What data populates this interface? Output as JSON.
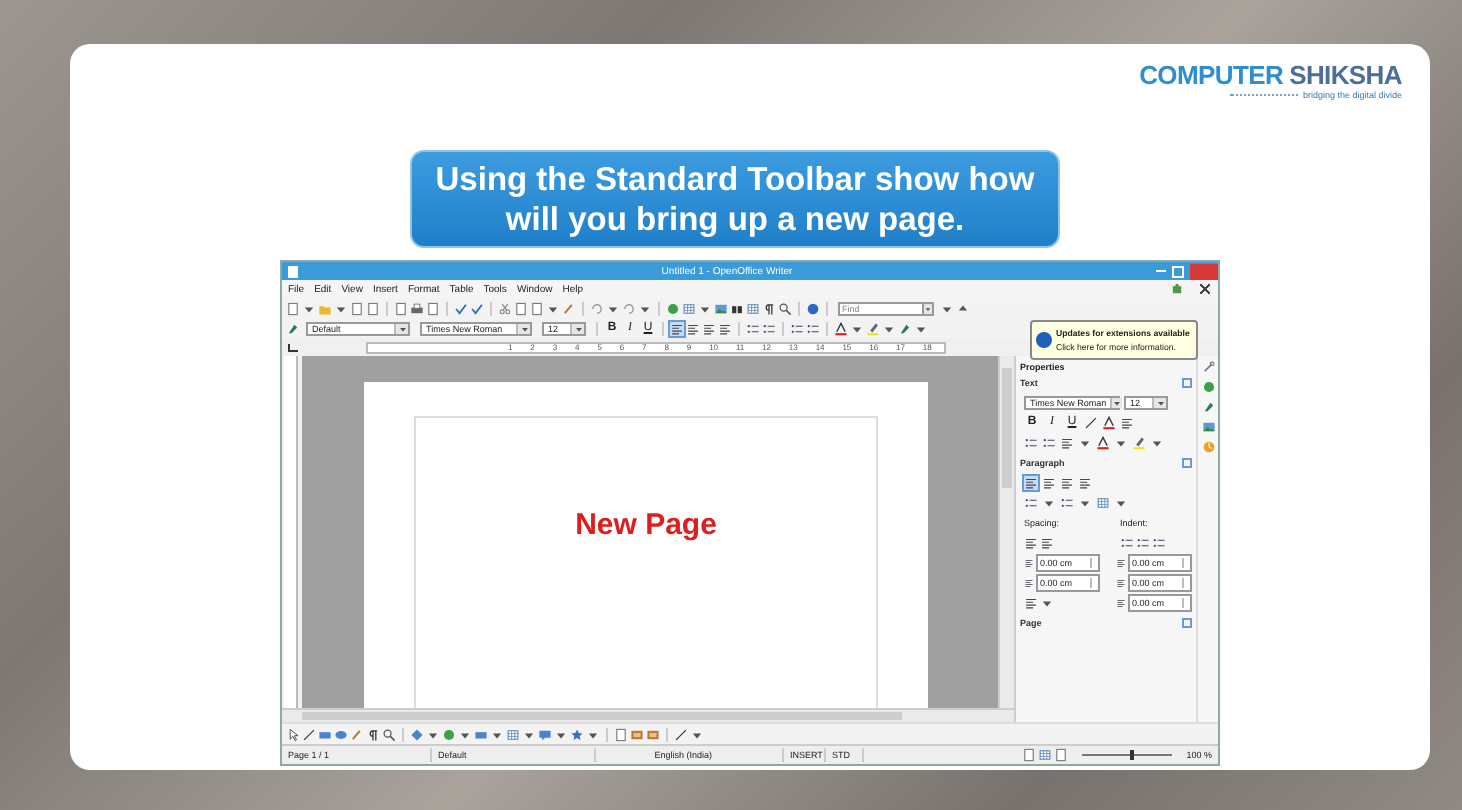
{
  "logo": {
    "brand_first": "COMPUTER",
    "brand_second": "SHIKSHA",
    "tagline": "bridging the digital divide"
  },
  "slide_title": "Using the Standard Toolbar show how will you bring up a new page.",
  "window": {
    "title": "Untitled 1 - OpenOffice Writer",
    "menu": [
      "File",
      "Edit",
      "View",
      "Insert",
      "Format",
      "Table",
      "Tools",
      "Window",
      "Help"
    ],
    "find_placeholder": "Find",
    "paragraph_style": "Default",
    "font_name": "Times New Roman",
    "font_size": "12",
    "format_buttons": [
      "B",
      "I",
      "U"
    ],
    "ruler_labels": [
      "1",
      "2",
      "3",
      "4",
      "5",
      "6",
      "7",
      "8",
      "9",
      "10",
      "11",
      "12",
      "13",
      "14",
      "15",
      "16",
      "17",
      "18"
    ],
    "notification": {
      "title": "Updates for extensions available",
      "message": "Click here for more information."
    },
    "document": {
      "text": "New Page"
    },
    "sidebar": {
      "title": "Properties",
      "text_section": {
        "label": "Text",
        "font_name": "Times New Roman",
        "font_size": "12",
        "format_buttons": [
          "B",
          "I",
          "U"
        ]
      },
      "paragraph_section": {
        "label": "Paragraph",
        "spacing_label": "Spacing:",
        "indent_label": "Indent:",
        "fields": [
          "0.00 cm",
          "0.00 cm",
          "0.00 cm",
          "0.00 cm",
          "0.00 cm"
        ]
      },
      "page_section": {
        "label": "Page"
      }
    },
    "status_bar": {
      "page": "Page 1 / 1",
      "style": "Default",
      "language": "English (India)",
      "mode": "INSERT",
      "selection": "STD",
      "zoom": "100 %"
    },
    "zoom_slider": {
      "level": 0.55
    }
  }
}
